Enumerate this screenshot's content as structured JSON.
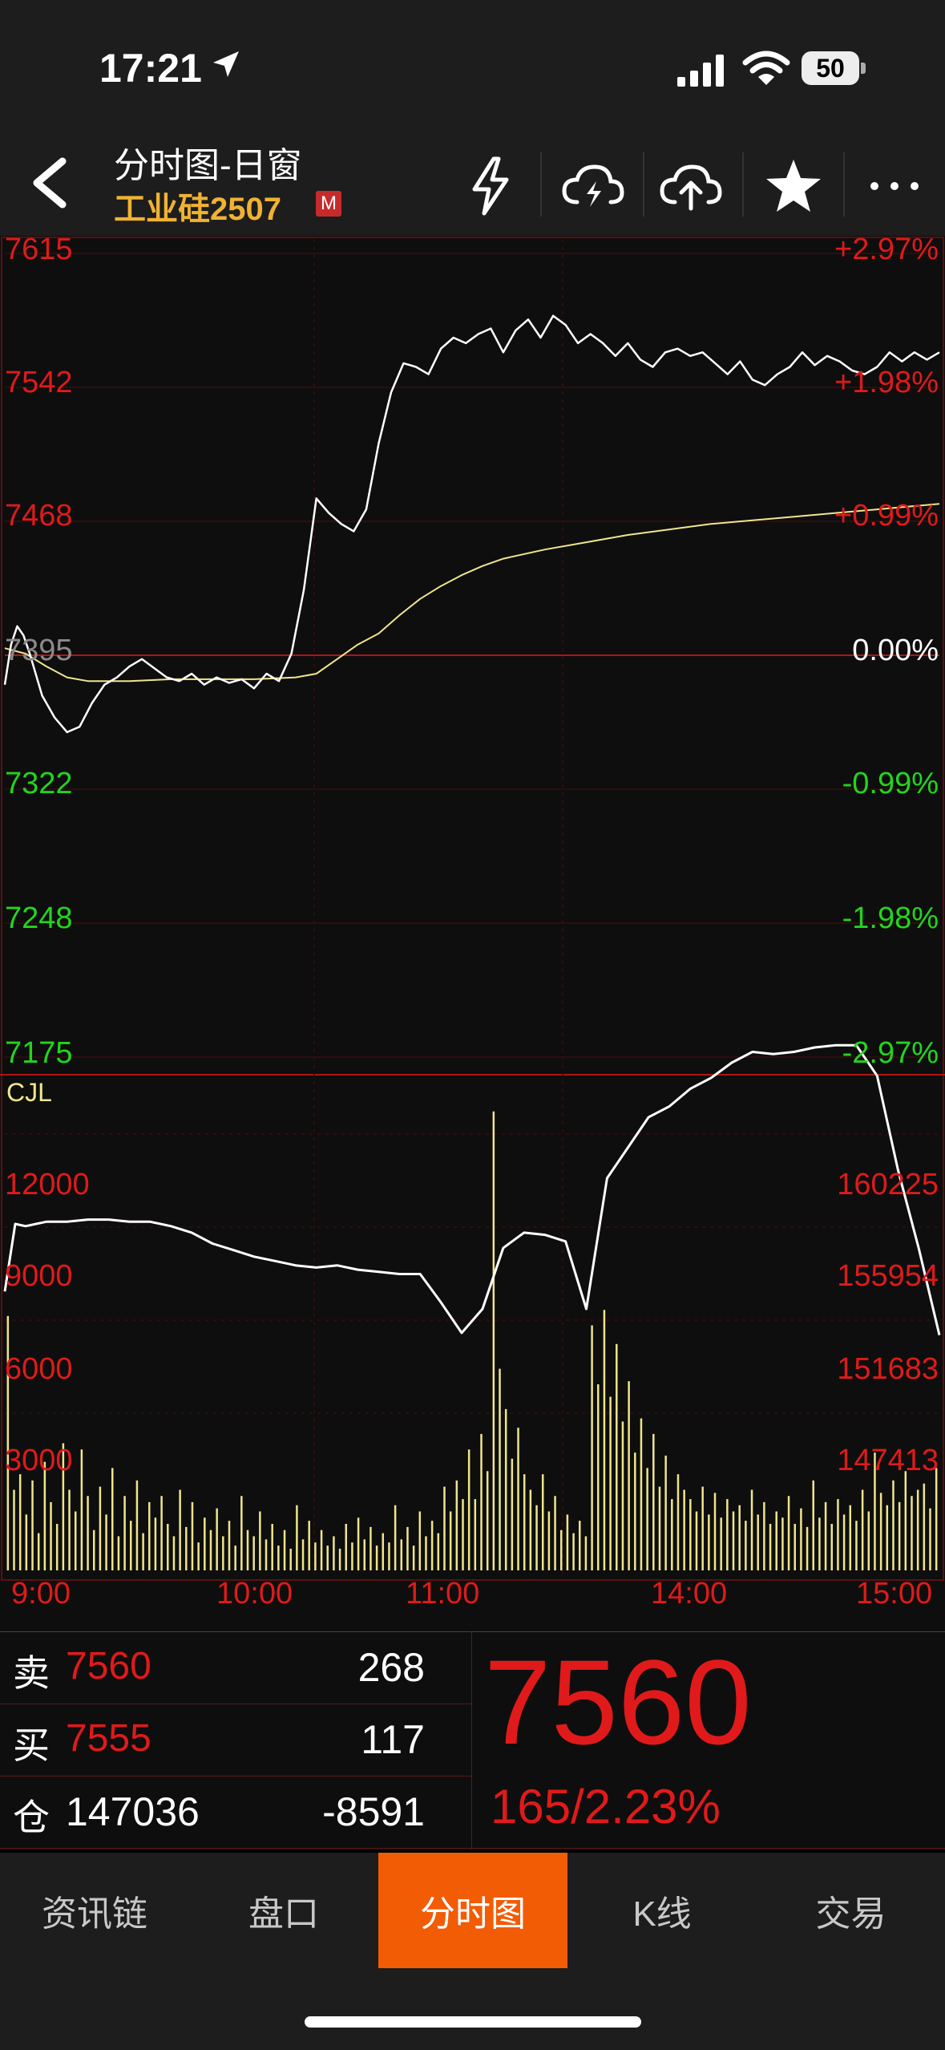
{
  "status": {
    "time": "17:21",
    "battery": "50"
  },
  "header": {
    "title": "分时图-日窗",
    "contract": "工业硅2507",
    "badge": "M"
  },
  "left_axis": [
    "7615",
    "7542",
    "7468",
    "7395",
    "7322",
    "7248",
    "7175"
  ],
  "right_axis": [
    "+2.97%",
    "+1.98%",
    "+0.99%",
    "0.00%",
    "-0.99%",
    "-1.98%",
    "-2.97%"
  ],
  "volume": {
    "label": "CJL",
    "left_ticks": [
      "12000",
      "9000",
      "6000",
      "3000"
    ],
    "right_ticks": [
      "160225",
      "155954",
      "151683",
      "147413"
    ]
  },
  "time_axis": [
    "9:00",
    "10:00",
    "11:00",
    "14:00",
    "15:00"
  ],
  "quote": {
    "sell_label": "卖",
    "sell_price": "7560",
    "sell_vol": "268",
    "buy_label": "买",
    "buy_price": "7555",
    "buy_vol": "117",
    "oi_label": "仓",
    "oi_value": "147036",
    "oi_change": "-8591",
    "last_price": "7560",
    "change": "165/2.23%"
  },
  "tabs": [
    {
      "label": "资讯链",
      "active": false
    },
    {
      "label": "盘口",
      "active": false
    },
    {
      "label": "分时图",
      "active": true
    },
    {
      "label": "K线",
      "active": false
    },
    {
      "label": "交易",
      "active": false
    }
  ],
  "colors": {
    "up": "#e01a1a",
    "down": "#22d51d",
    "accent": "#f25c05",
    "contract": "#f0b232",
    "avg_line": "#f0e68c"
  },
  "chart_data": [
    {
      "type": "line",
      "series": [
        {
          "name": "",
          "x": [
            0,
            3,
            6,
            9,
            12,
            18,
            24,
            30,
            36,
            42,
            48,
            54,
            60,
            66,
            72,
            78,
            84,
            90,
            96,
            102,
            108,
            114,
            120,
            126,
            132,
            138,
            144,
            150,
            156,
            162,
            168,
            174,
            180,
            186,
            192,
            198,
            204,
            210,
            216,
            222,
            228,
            234,
            240,
            246,
            252,
            258,
            264,
            270,
            276,
            282,
            288,
            294,
            300,
            306,
            312,
            318,
            324,
            330,
            336,
            342,
            348,
            354,
            360,
            366,
            372,
            378,
            384,
            390,
            396,
            402,
            408,
            414,
            420,
            426,
            432,
            438,
            444,
            450
          ],
          "values": [
            7378,
            7400,
            7410,
            7405,
            7395,
            7372,
            7360,
            7352,
            7355,
            7368,
            7378,
            7382,
            7388,
            7392,
            7387,
            7382,
            7380,
            7384,
            7378,
            7382,
            7379,
            7381,
            7376,
            7384,
            7380,
            7395,
            7430,
            7480,
            7472,
            7466,
            7462,
            7474,
            7510,
            7538,
            7554,
            7552,
            7548,
            7562,
            7568,
            7565,
            7570,
            7573,
            7560,
            7572,
            7578,
            7568,
            7580,
            7575,
            7565,
            7570,
            7565,
            7558,
            7565,
            7556,
            7552,
            7560,
            7562,
            7558,
            7560,
            7554,
            7548,
            7555,
            7545,
            7542,
            7548,
            7552,
            7560,
            7553,
            7558,
            7555,
            7550,
            7548,
            7552,
            7560,
            7555,
            7560,
            7556,
            7560
          ]
        },
        {
          "name": "",
          "x": [
            0,
            10,
            20,
            30,
            40,
            60,
            80,
            100,
            120,
            140,
            150,
            160,
            170,
            180,
            190,
            200,
            210,
            220,
            230,
            240,
            260,
            280,
            300,
            320,
            340,
            360,
            380,
            400,
            420,
            440,
            450
          ],
          "values": [
            7398,
            7395,
            7388,
            7382,
            7380,
            7380,
            7381,
            7381,
            7381,
            7382,
            7384,
            7392,
            7400,
            7406,
            7416,
            7425,
            7432,
            7438,
            7443,
            7447,
            7452,
            7456,
            7460,
            7463,
            7466,
            7468,
            7470,
            7472,
            7474,
            7476,
            7477
          ]
        }
      ],
      "ylim": [
        7175,
        7615
      ]
    },
    {
      "type": "bar",
      "series": [
        {
          "name": "CJL",
          "values": [
            8200,
            2600,
            3100,
            1800,
            2900,
            1200,
            3500,
            2200,
            1500,
            4100,
            2600,
            1900,
            3900,
            2400,
            1300,
            2700,
            1800,
            3300,
            1100,
            2400,
            1600,
            2900,
            1200,
            2200,
            1700,
            2400,
            1500,
            1100,
            2600,
            1400,
            2200,
            900,
            1700,
            1300,
            2000,
            1100,
            1600,
            800,
            2400,
            1300,
            1100,
            1900,
            1000,
            1500,
            800,
            1300,
            700,
            2100,
            1000,
            1600,
            900,
            1300,
            800,
            1100,
            700,
            1500,
            900,
            1700,
            1000,
            1400,
            800,
            1200,
            900,
            2100,
            1000,
            1400,
            800,
            1900,
            1100,
            1600,
            1200,
            2700,
            1900,
            2900,
            2300,
            3900,
            2300,
            4400,
            3200,
            14800,
            6500,
            5200,
            3600,
            4600,
            3100,
            2600,
            2100,
            3100,
            1900,
            2400,
            1300,
            1800,
            1200,
            1600,
            1100,
            7900,
            6000,
            8400,
            5600,
            7300,
            4800,
            6100,
            3800,
            4900,
            3300,
            4400,
            2700,
            3700,
            2300,
            3100,
            2600,
            2300,
            1900,
            2700,
            1800,
            2500,
            1700,
            2300,
            1900,
            2100,
            1600,
            2600,
            1800,
            2200,
            1500,
            1900,
            1700,
            2400,
            1500,
            2000,
            1400,
            2900,
            1700,
            2200,
            1500,
            2300,
            1800,
            2100,
            1600,
            2600,
            1900,
            3800,
            2500,
            2100,
            2900,
            2200,
            3200,
            2400,
            2600,
            2800,
            2000,
            3300
          ]
        },
        {
          "name": "",
          "x": [
            0,
            5,
            10,
            20,
            30,
            40,
            50,
            60,
            70,
            80,
            90,
            100,
            110,
            120,
            130,
            140,
            150,
            160,
            170,
            180,
            190,
            200,
            210,
            220,
            230,
            240,
            250,
            260,
            270,
            280,
            290,
            300,
            310,
            320,
            330,
            340,
            350,
            360,
            370,
            380,
            390,
            400,
            410,
            420,
            430,
            440,
            450
          ],
          "values": [
            153000,
            156100,
            156000,
            156200,
            156200,
            156300,
            156300,
            156200,
            156200,
            156000,
            155700,
            155200,
            154900,
            154600,
            154400,
            154200,
            154100,
            154200,
            154000,
            153900,
            153800,
            153800,
            152500,
            151100,
            152200,
            155000,
            155700,
            155600,
            155300,
            152200,
            158200,
            159600,
            161000,
            161500,
            162300,
            162800,
            163500,
            164000,
            163900,
            164000,
            164200,
            164300,
            164300,
            162900,
            158600,
            155000,
            151000
          ]
        }
      ],
      "ylim": [
        0,
        15000
      ]
    }
  ]
}
